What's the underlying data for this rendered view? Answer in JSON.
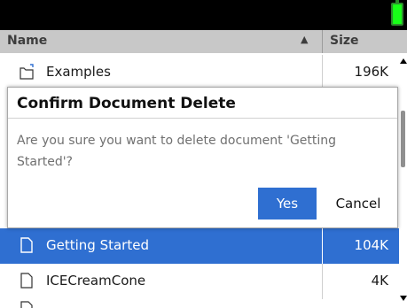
{
  "header": {
    "name_label": "Name",
    "size_label": "Size",
    "sort_glyph": "▲"
  },
  "files": [
    {
      "name": "Examples",
      "size": "196K",
      "icon": "folder-icon"
    },
    {
      "name": "Getting Started",
      "size": "104K",
      "icon": "document-icon",
      "selected": true
    },
    {
      "name": "ICECreamCone",
      "size": "4K",
      "icon": "document-icon"
    }
  ],
  "dialog": {
    "title": "Confirm Document Delete",
    "message": "Are you sure you want to delete document 'Getting Started'?",
    "yes_label": "Yes",
    "cancel_label": "Cancel"
  },
  "colors": {
    "accent": "#2f6fd1",
    "header_bg": "#c8c8c8",
    "battery": "#18ff18"
  }
}
